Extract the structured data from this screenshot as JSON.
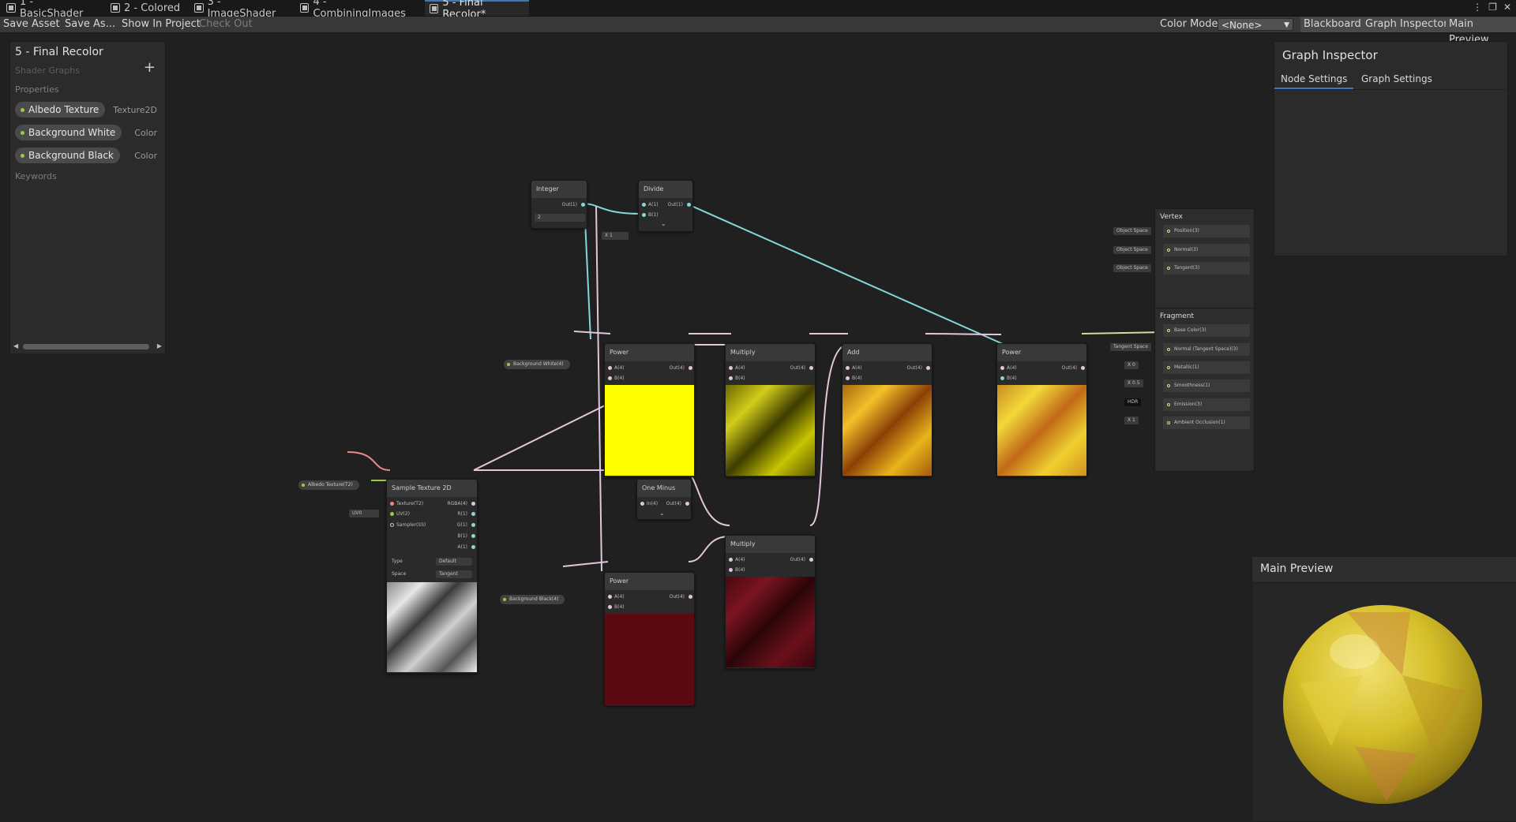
{
  "tabs": [
    {
      "label": "1 - BasicShader"
    },
    {
      "label": "2 - Colored"
    },
    {
      "label": "3 - ImageShader"
    },
    {
      "label": "4 - CombiningImages"
    },
    {
      "label": "5 - Final Recolor*"
    }
  ],
  "window_controls": {
    "menu": "⋮",
    "maximize": "❐",
    "close": "✕"
  },
  "toolbar": {
    "save_asset": "Save Asset",
    "save_as": "Save As...",
    "show_in_project": "Show In Project",
    "check_out": "Check Out",
    "color_mode_label": "Color Mode",
    "color_mode_value": "<None>",
    "blackboard": "Blackboard",
    "graph_inspector": "Graph Inspector",
    "main_preview": "Main Preview"
  },
  "blackboard": {
    "title": "5 - Final Recolor",
    "subtitle": "Shader Graphs",
    "add": "+",
    "properties_label": "Properties",
    "properties": [
      {
        "name": "Albedo Texture",
        "type": "Texture2D"
      },
      {
        "name": "Background White",
        "type": "Color"
      },
      {
        "name": "Background Black",
        "type": "Color"
      }
    ],
    "keywords_label": "Keywords"
  },
  "inspector": {
    "title": "Graph Inspector",
    "tabs": [
      "Node Settings",
      "Graph Settings"
    ]
  },
  "main_preview": {
    "title": "Main Preview"
  },
  "colors": {
    "accent": "#3a79bb",
    "float_wire": "#86d7d7",
    "vector_wire": "#e2c6dd",
    "yellow": "#ffff00",
    "dark_red": "#5a0a10"
  },
  "nodes": {
    "integer": {
      "title": "Integer",
      "out": "Out(1)",
      "value": "2"
    },
    "divide": {
      "title": "Divide",
      "a": "A(1)",
      "b": "B(1)",
      "a_stub": "X  1",
      "out": "Out(1)"
    },
    "power1": {
      "title": "Power",
      "a": "A(4)",
      "b": "B(4)",
      "out": "Out(4)"
    },
    "multiply1": {
      "title": "Multiply",
      "a": "A(4)",
      "b": "B(4)",
      "out": "Out(4)"
    },
    "add": {
      "title": "Add",
      "a": "A(4)",
      "b": "B(4)",
      "out": "Out(4)"
    },
    "power3": {
      "title": "Power",
      "a": "A(4)",
      "b": "B(4)",
      "out": "Out(4)"
    },
    "one_minus": {
      "title": "One Minus",
      "in": "In(4)",
      "out": "Out(4)"
    },
    "multiply2": {
      "title": "Multiply",
      "a": "A(4)",
      "b": "B(4)",
      "out": "Out(4)"
    },
    "power2": {
      "title": "Power",
      "a": "A(4)",
      "b": "B(4)",
      "out": "Out(4)"
    },
    "sample_texture": {
      "title": "Sample Texture 2D",
      "inputs": [
        "Texture(T2)",
        "UV(2)",
        "Sampler(SS)"
      ],
      "outputs": [
        "RGBA(4)",
        "R(1)",
        "G(1)",
        "B(1)",
        "A(1)"
      ],
      "type_label": "Type",
      "type_value": "Default",
      "space_label": "Space",
      "space_value": "Tangent",
      "uv_stub": "UV0"
    }
  },
  "property_nodes": {
    "albedo": "Albedo Texture(T2)",
    "bg_white": "Background White(4)",
    "bg_black": "Background Black(4)"
  },
  "master": {
    "vertex": {
      "title": "Vertex",
      "slots": [
        "Position(3)",
        "Normal(3)",
        "Tangent(3)"
      ],
      "stubs": [
        "Object Space",
        "Object Space",
        "Object Space"
      ]
    },
    "fragment": {
      "title": "Fragment",
      "slots": [
        "Base Color(3)",
        "Normal (Tangent Space)(3)",
        "Metallic(1)",
        "Smoothness(1)",
        "Emission(3)",
        "Ambient Occlusion(1)"
      ],
      "stubs": [
        "",
        "Tangent Space",
        "X  0",
        "X  0.5",
        "HDR",
        "X  1"
      ]
    }
  }
}
